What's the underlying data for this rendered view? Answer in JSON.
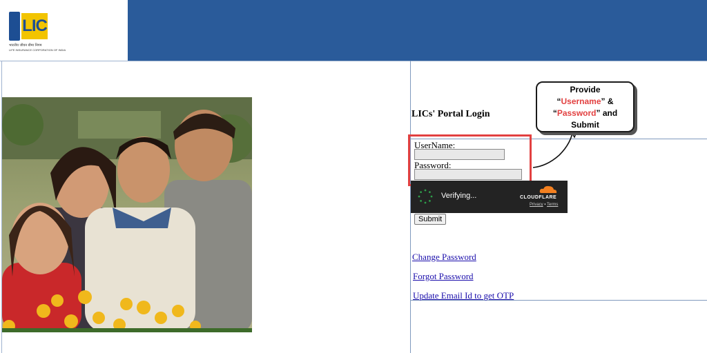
{
  "logo": {
    "text": "LIC",
    "hindi": "भारतीय जीवन बीमा निगम",
    "english": "LIFE INSURANCE CORPORATION OF INDIA",
    "icon": "lic-emblem-icon"
  },
  "colors": {
    "header": "#2a5b9a",
    "callout_accent": "#e24040",
    "link": "#1a0dab",
    "captcha_bg": "#232323"
  },
  "login": {
    "title": "LICs' Portal Login",
    "username_label": "UserName:",
    "username_value": "",
    "password_label": "Password:",
    "password_value": "",
    "submit_label": "Submit"
  },
  "captcha": {
    "status": "Verifying...",
    "brand": "CLOUDFLARE",
    "privacy": "Privacy",
    "separator": "•",
    "terms": "Terms",
    "icon": "cloudflare-cloud-icon"
  },
  "links": {
    "change_password": "Change Password",
    "forgot_password": "Forgot Password",
    "update_email": "Update Email Id to get OTP"
  },
  "callout": {
    "line1": "Provide",
    "open_quote": "“",
    "username": "Username",
    "mid": "” &",
    "open_quote2": "“",
    "password": "Password",
    "end": "” and",
    "line4": "Submit"
  }
}
